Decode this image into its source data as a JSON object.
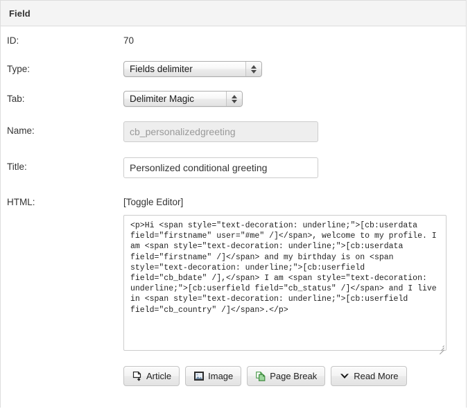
{
  "panel": {
    "title": "Field"
  },
  "form": {
    "id": {
      "label": "ID:",
      "value": "70"
    },
    "type": {
      "label": "Type:",
      "value": "Fields delimiter"
    },
    "tab": {
      "label": "Tab:",
      "value": "Delimiter Magic"
    },
    "name": {
      "label": "Name:",
      "value": "cb_personalizedgreeting"
    },
    "title": {
      "label": "Title:",
      "value": "Personlized conditional greeting"
    },
    "html": {
      "label": "HTML:",
      "toggle_editor": "[Toggle Editor]",
      "content": "<p>Hi <span style=\"text-decoration: underline;\">[cb:userdata field=\"firstname\" user=\"#me\" /]</span>, welcome to my profile. I am <span style=\"text-decoration: underline;\">[cb:userdata field=\"firstname\" /]</span> and my birthday is on <span style=\"text-decoration: underline;\">[cb:userfield field=\"cb_bdate\" /],</span> I am <span style=\"text-decoration: underline;\">[cb:userfield field=\"cb_status\" /]</span> and I live in <span style=\"text-decoration: underline;\">[cb:userfield field=\"cb_country\" /]</span>.</p>"
    }
  },
  "editor_buttons": [
    {
      "label": "Article",
      "icon": "article-icon"
    },
    {
      "label": "Image",
      "icon": "image-icon"
    },
    {
      "label": "Page Break",
      "icon": "page-break-icon"
    },
    {
      "label": "Read More",
      "icon": "read-more-icon"
    }
  ],
  "colors": {
    "header_bg": "#f4f4f4",
    "border": "#dddddd",
    "text": "#333333",
    "disabled_bg": "#eeeeee",
    "page_break_green": "#58a058"
  }
}
